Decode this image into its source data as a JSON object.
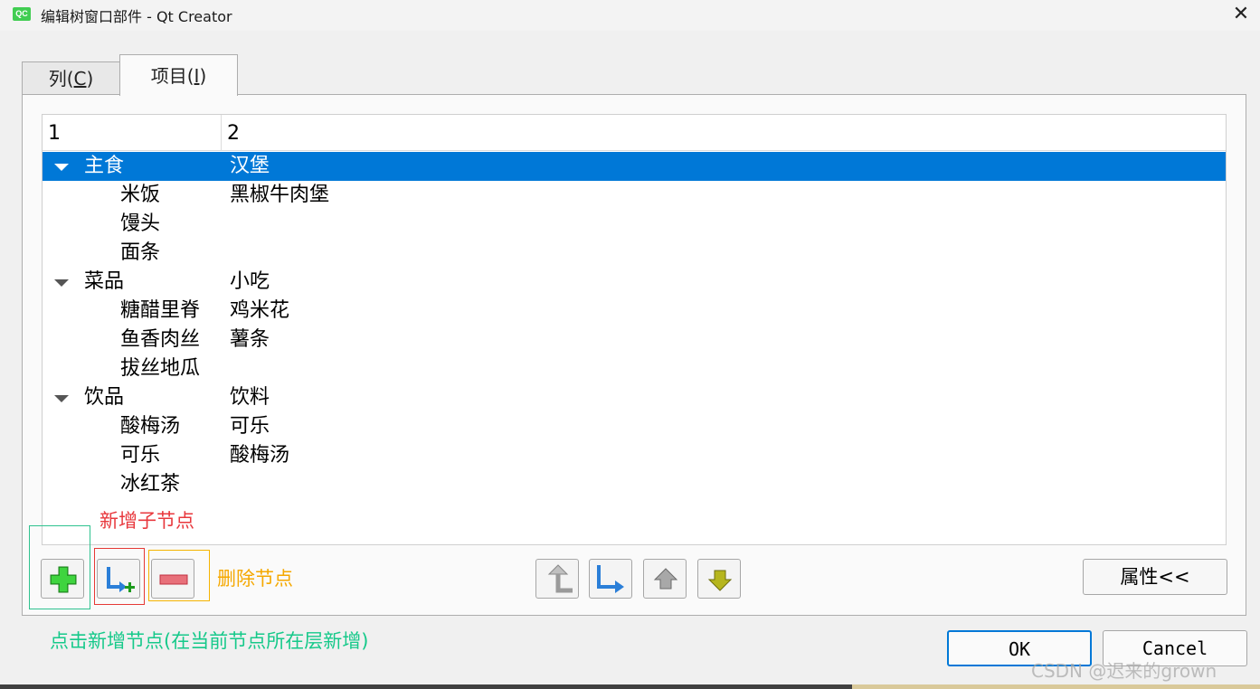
{
  "window": {
    "app_icon_text": "QC",
    "title": "编辑树窗口部件 - Qt Creator",
    "close_glyph": "✕"
  },
  "tabs": [
    {
      "label": "列",
      "mnemonic": "C",
      "active": false
    },
    {
      "label": "项目",
      "mnemonic": "I",
      "active": true
    }
  ],
  "tree": {
    "headers": [
      "1",
      "2"
    ],
    "rows": [
      {
        "col1": "主食",
        "col2": "汉堡",
        "level": 0,
        "expanded": true,
        "selected": true
      },
      {
        "col1": "米饭",
        "col2": "黑椒牛肉堡",
        "level": 1
      },
      {
        "col1": "馒头",
        "col2": "",
        "level": 1
      },
      {
        "col1": "面条",
        "col2": "",
        "level": 1
      },
      {
        "col1": "菜品",
        "col2": "小吃",
        "level": 0,
        "expanded": true
      },
      {
        "col1": "糖醋里脊",
        "col2": "鸡米花",
        "level": 1
      },
      {
        "col1": "鱼香肉丝",
        "col2": "薯条",
        "level": 1
      },
      {
        "col1": "拔丝地瓜",
        "col2": "",
        "level": 1
      },
      {
        "col1": "饮品",
        "col2": "饮料",
        "level": 0,
        "expanded": true
      },
      {
        "col1": "酸梅汤",
        "col2": "可乐",
        "level": 1
      },
      {
        "col1": "可乐",
        "col2": "酸梅汤",
        "level": 1
      },
      {
        "col1": "冰红茶",
        "col2": "",
        "level": 1
      }
    ]
  },
  "annotations": {
    "add_child": "新增子节点",
    "delete": "删除节点",
    "add_sibling": "点击新增节点(在当前节点所在层新增)"
  },
  "toolbar": {
    "icons": [
      "add-item-icon",
      "add-subitem-icon",
      "delete-item-icon",
      "move-left-icon",
      "move-right-icon",
      "move-up-icon",
      "move-down-icon"
    ],
    "properties_label": "属性<<"
  },
  "dialog": {
    "ok_label": "OK",
    "cancel_label": "Cancel"
  },
  "watermark": "CSDN @迟来的grown",
  "colors": {
    "selection": "#0078d7",
    "annot_red": "#e8383d",
    "annot_orange": "#f5a800",
    "annot_green": "#16c98a"
  }
}
